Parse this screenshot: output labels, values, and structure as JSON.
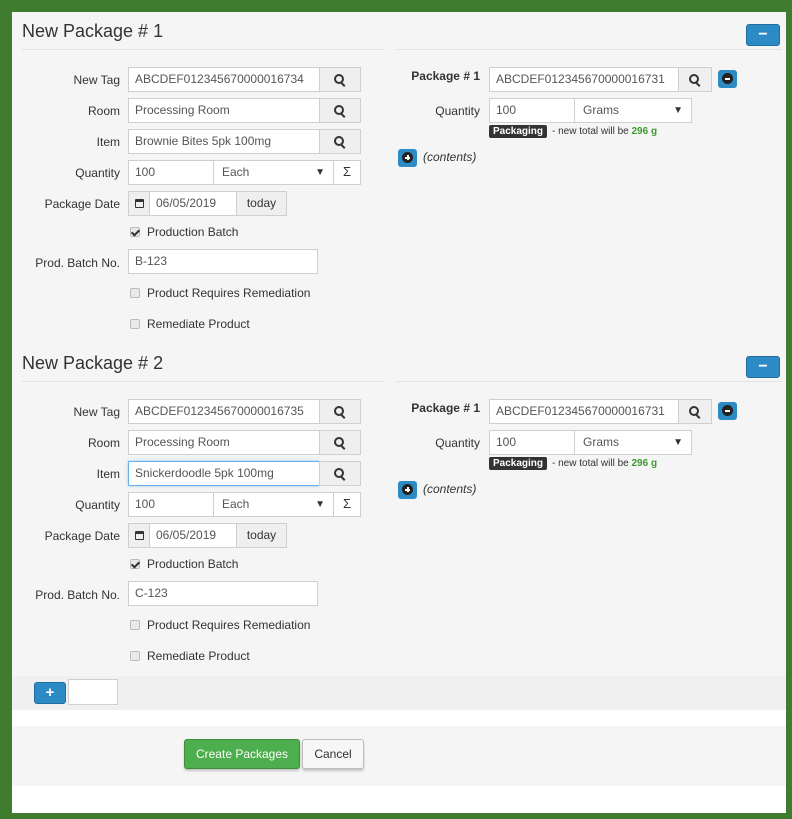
{
  "packages": [
    {
      "title": "New Package # 1",
      "minus_label": "−",
      "new_tag_label": "New Tag",
      "new_tag": "ABCDEF012345670000016734",
      "room_label": "Room",
      "room": "Processing Room",
      "item_label": "Item",
      "item": "Brownie Bites 5pk 100mg",
      "quantity_label": "Quantity",
      "quantity": "100",
      "unit": "Each",
      "sigma": "Σ",
      "package_date_label": "Package Date",
      "package_date": "06/05/2019",
      "today_label": "today",
      "production_batch_label": "Production Batch",
      "production_batch_checked": true,
      "prod_batch_no_label": "Prod. Batch No.",
      "prod_batch_no": "B-123",
      "requires_remediation_label": "Product Requires Remediation",
      "remediate_label": "Remediate Product",
      "source": {
        "label": "Package # 1",
        "tag": "ABCDEF012345670000016731",
        "quantity_label": "Quantity",
        "quantity": "100",
        "unit": "Grams",
        "badge": "Packaging",
        "note_prefix": "- new total will be",
        "note_total": "296 g",
        "contents_label": "(contents)"
      }
    },
    {
      "title": "New Package # 2",
      "minus_label": "−",
      "new_tag_label": "New Tag",
      "new_tag": "ABCDEF012345670000016735",
      "room_label": "Room",
      "room": "Processing Room",
      "item_label": "Item",
      "item": "Snickerdoodle 5pk 100mg",
      "quantity_label": "Quantity",
      "quantity": "100",
      "unit": "Each",
      "sigma": "Σ",
      "package_date_label": "Package Date",
      "package_date": "06/05/2019",
      "today_label": "today",
      "production_batch_label": "Production Batch",
      "production_batch_checked": true,
      "prod_batch_no_label": "Prod. Batch No.",
      "prod_batch_no": "C-123",
      "requires_remediation_label": "Product Requires Remediation",
      "remediate_label": "Remediate Product",
      "source": {
        "label": "Package # 1",
        "tag": "ABCDEF012345670000016731",
        "quantity_label": "Quantity",
        "quantity": "100",
        "unit": "Grams",
        "badge": "Packaging",
        "note_prefix": "- new total will be",
        "note_total": "296 g",
        "contents_label": "(contents)"
      }
    }
  ],
  "footer": {
    "add_label": "+",
    "create_label": "Create Packages",
    "cancel_label": "Cancel"
  },
  "colors": {
    "frame_green": "#3f7c30",
    "accent_blue": "#2c8ac4",
    "create_green": "#4cae4c",
    "total_green": "#3c9a2f"
  }
}
